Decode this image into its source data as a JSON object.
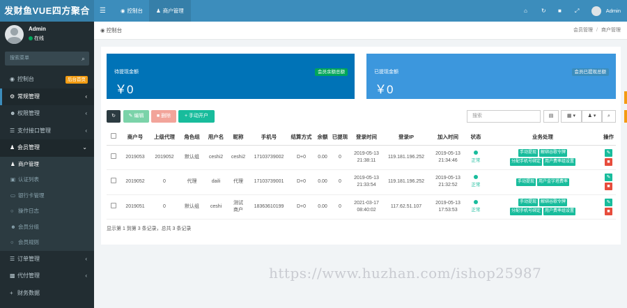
{
  "sidebar": {
    "logo": "发财鱼VUE四方聚合",
    "user": {
      "name": "Admin",
      "status": "在线"
    },
    "search_placeholder": "搜索菜单",
    "items": [
      {
        "label": "控制台",
        "badge": "后台首页",
        "icon": "dashboard-icon"
      },
      {
        "label": "常规管理",
        "icon": "cogs-icon"
      },
      {
        "label": "权限管理",
        "icon": "group-icon"
      },
      {
        "label": "支付接口管理",
        "icon": "list-icon"
      },
      {
        "label": "会员管理",
        "icon": "user-icon"
      }
    ],
    "subitems": [
      {
        "label": "商户管理",
        "icon": "user-icon"
      },
      {
        "label": "认证列表",
        "icon": "id-card-icon"
      },
      {
        "label": "银行卡管理",
        "icon": "credit-card-icon"
      },
      {
        "label": "操作日志",
        "icon": "circle-icon"
      },
      {
        "label": "会员分组",
        "icon": "group-icon"
      },
      {
        "label": "会员规则",
        "icon": "circle-icon"
      }
    ],
    "bottom_items": [
      {
        "label": "订单管理",
        "icon": "list-icon"
      },
      {
        "label": "代付管理",
        "icon": "desktop-icon"
      },
      {
        "label": "财务数据",
        "icon": "plus-icon"
      }
    ]
  },
  "topnav": {
    "tabs": [
      {
        "label": "控制台",
        "icon": "dashboard-icon"
      },
      {
        "label": "商户管理",
        "icon": "user-icon"
      }
    ],
    "user_name": "Admin"
  },
  "content": {
    "page_title": "控制台",
    "breadcrumb": [
      "会员管理",
      "商户管理"
    ],
    "stats": [
      {
        "label": "待提现金额",
        "value": "￥0",
        "tag": "会员余额总额"
      },
      {
        "label": "已提现金额",
        "value": "￥0",
        "tag": "会员已提现总额"
      }
    ],
    "toolbar": {
      "refresh_icon": "refresh-icon",
      "edit": "编辑",
      "delete": "删除",
      "add": "手动开户",
      "search_placeholder": "搜索"
    },
    "table": {
      "headers": [
        "",
        "商户号",
        "上级代理",
        "角色组",
        "用户名",
        "昵称",
        "手机号",
        "结算方式",
        "余额",
        "已提现",
        "登录时间",
        "登录IP",
        "加入时间",
        "状态",
        "业务处理",
        "操作"
      ],
      "rows": [
        {
          "id": "2019053",
          "parent": "2019052",
          "role": "默认组",
          "username": "ceshi2",
          "nickname": "ceshi2",
          "phone": "17103739002",
          "settle": "D+0",
          "balance": "0.00",
          "withdrawn": "0",
          "login_time": [
            "2019-05-13",
            "21:38:11"
          ],
          "login_ip": "119.181.196.252",
          "join_time": [
            "2019-05-13",
            "21:34:46"
          ],
          "status": "正常",
          "actions": [
            "手动提现",
            "解绑谷歌令牌",
            "分配手机号绑定",
            "用户费率组设置"
          ]
        },
        {
          "id": "2019052",
          "parent": "0",
          "role": "代理",
          "username": "daili",
          "nickname": "代理",
          "phone": "17103739001",
          "settle": "D+0",
          "balance": "0.00",
          "withdrawn": "0",
          "login_time": [
            "2019-05-13",
            "21:33:54"
          ],
          "login_ip": "119.181.196.252",
          "join_time": [
            "2019-05-13",
            "21:32:52"
          ],
          "status": "正常",
          "actions": [
            "手动提现",
            "用户金字塔费率"
          ]
        },
        {
          "id": "2019051",
          "parent": "0",
          "role": "默认组",
          "username": "ceshi",
          "nickname": [
            "测试",
            "商户"
          ],
          "phone": "18363610199",
          "settle": "D+0",
          "balance": "0.00",
          "withdrawn": "0",
          "login_time": [
            "2021-03-17",
            "08:40:02"
          ],
          "login_ip": "117.62.51.107",
          "join_time": [
            "2019-05-13",
            "17:53:53"
          ],
          "status": "正常",
          "actions": [
            "手动提现",
            "解绑谷歌令牌",
            "分配手机号绑定",
            "用户费率组设置"
          ]
        }
      ],
      "footer": "显示第 1 到第 3 条记录，总共 3 条记录"
    }
  },
  "watermark": "https://www.huzhan.com/ishop25987"
}
